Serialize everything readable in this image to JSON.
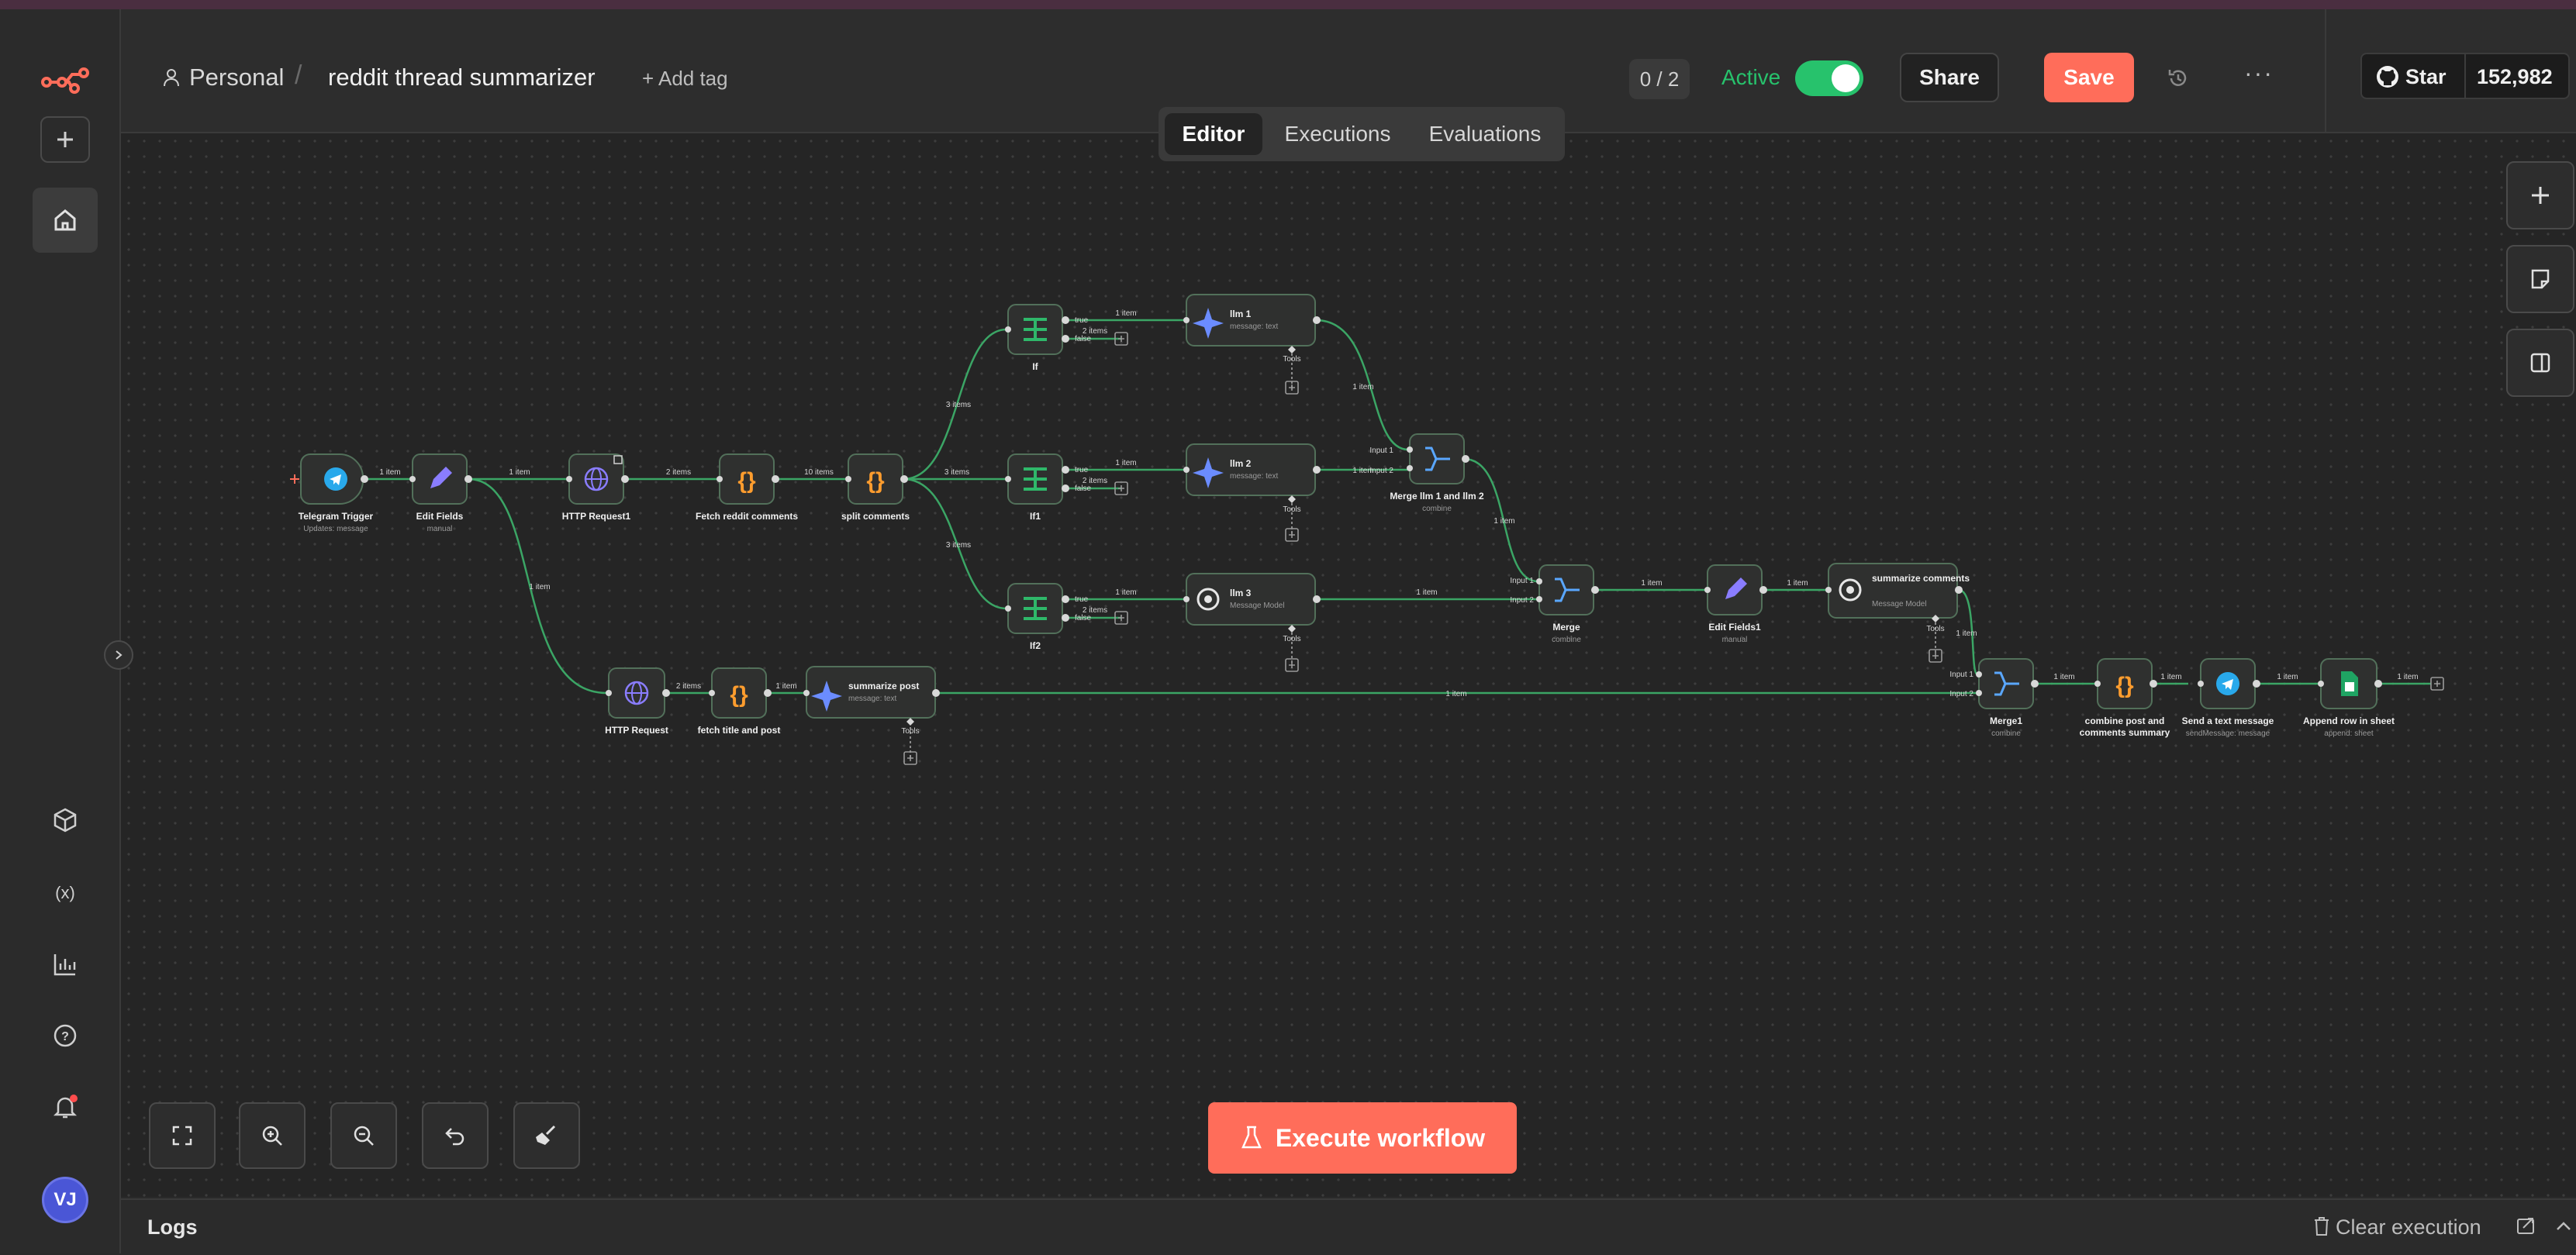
{
  "header": {
    "project": "Personal",
    "workflow_name": "reddit thread summarizer",
    "add_tag": "+ Add tag",
    "counter": "0 / 2",
    "active_label": "Active",
    "share": "Share",
    "save": "Save",
    "github_star": "Star",
    "github_count": "152,982"
  },
  "tabs": [
    "Editor",
    "Executions",
    "Evaluations"
  ],
  "execute_button": "Execute workflow",
  "logs": {
    "title": "Logs",
    "clear": "Clear execution"
  },
  "user_initials": "VJ",
  "colors": {
    "accent": "#ff6d5a",
    "active_green": "#27c26c",
    "edge": "#3ba565",
    "node_border": "#4b6150"
  },
  "nodes": {
    "telegram_trigger": {
      "label": "Telegram Trigger",
      "sub": "Updates: message",
      "icon": "telegram-icon"
    },
    "edit_fields": {
      "label": "Edit Fields",
      "sub": "manual",
      "icon": "pencil-icon"
    },
    "http_request1": {
      "label": "HTTP Request1",
      "sub": "",
      "icon": "globe-icon"
    },
    "fetch_reddit_comments": {
      "label": "Fetch reddit comments",
      "sub": "",
      "icon": "code-braces-icon"
    },
    "split_comments": {
      "label": "split comments",
      "sub": "",
      "icon": "code-braces-icon"
    },
    "if": {
      "label": "If",
      "sub": "",
      "icon": "if-icon"
    },
    "if1": {
      "label": "If1",
      "sub": "",
      "icon": "if-icon"
    },
    "if2": {
      "label": "If2",
      "sub": "",
      "icon": "if-icon"
    },
    "llm1": {
      "label": "llm 1",
      "sub": "message: text",
      "icon": "gemini-icon"
    },
    "llm2": {
      "label": "llm 2",
      "sub": "message: text",
      "icon": "gemini-icon"
    },
    "llm3": {
      "label": "llm 3",
      "sub": "Message Model",
      "icon": "openai-icon"
    },
    "merge_llm": {
      "label": "Merge llm 1 and llm 2",
      "sub": "combine",
      "icon": "merge-icon"
    },
    "merge": {
      "label": "Merge",
      "sub": "combine",
      "icon": "merge-icon"
    },
    "edit_fields1": {
      "label": "Edit Fields1",
      "sub": "manual",
      "icon": "pencil-icon"
    },
    "summarize_comments": {
      "label": "summarize comments",
      "sub": "Message Model",
      "icon": "openai-icon"
    },
    "http_request": {
      "label": "HTTP Request",
      "sub": "",
      "icon": "globe-icon"
    },
    "fetch_title_post": {
      "label": "fetch title and post",
      "sub": "",
      "icon": "code-braces-icon"
    },
    "summarize_post": {
      "label": "summarize post",
      "sub": "message: text",
      "icon": "gemini-icon"
    },
    "merge1": {
      "label": "Merge1",
      "sub": "combine",
      "icon": "merge-icon"
    },
    "combine_summary": {
      "label": "combine post and comments summary",
      "sub": "",
      "icon": "code-braces-icon"
    },
    "send_text": {
      "label": "Send a text message",
      "sub": "sendMessage: message",
      "icon": "telegram-icon"
    },
    "append_row": {
      "label": "Append row in sheet",
      "sub": "append: sheet",
      "icon": "sheets-icon"
    }
  },
  "edge_labels": {
    "one_item": "1 item",
    "two_items": "2 items",
    "three_items": "3 items",
    "ten_items": "10 items",
    "true": "true",
    "false": "false",
    "input1": "Input 1",
    "input2": "Input 2",
    "tools": "Tools"
  }
}
